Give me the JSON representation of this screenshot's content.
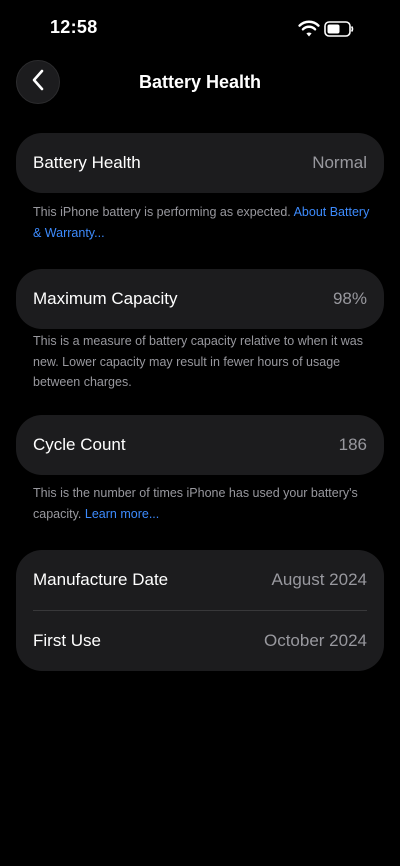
{
  "status_bar": {
    "time": "12:58"
  },
  "nav": {
    "title": "Battery Health"
  },
  "battery_health": {
    "label": "Battery Health",
    "value": "Normal",
    "footnote": "This iPhone battery is performing as expected.",
    "link": "About Battery & Warranty..."
  },
  "maximum_capacity": {
    "label": "Maximum Capacity",
    "value": "98%",
    "footnote": "This is a measure of battery capacity relative to when it was new. Lower capacity may result in fewer hours of usage between charges."
  },
  "cycle_count": {
    "label": "Cycle Count",
    "value": "186",
    "footnote": "This is the number of times iPhone has used your battery's capacity.",
    "link": "Learn more..."
  },
  "dates": {
    "manufacture_label": "Manufacture Date",
    "manufacture_value": "August 2024",
    "first_use_label": "First Use",
    "first_use_value": "October 2024"
  },
  "colors": {
    "background": "#000000",
    "card": "#1c1c1e",
    "secondary_text": "#98989e",
    "link": "#3d8bfd"
  }
}
